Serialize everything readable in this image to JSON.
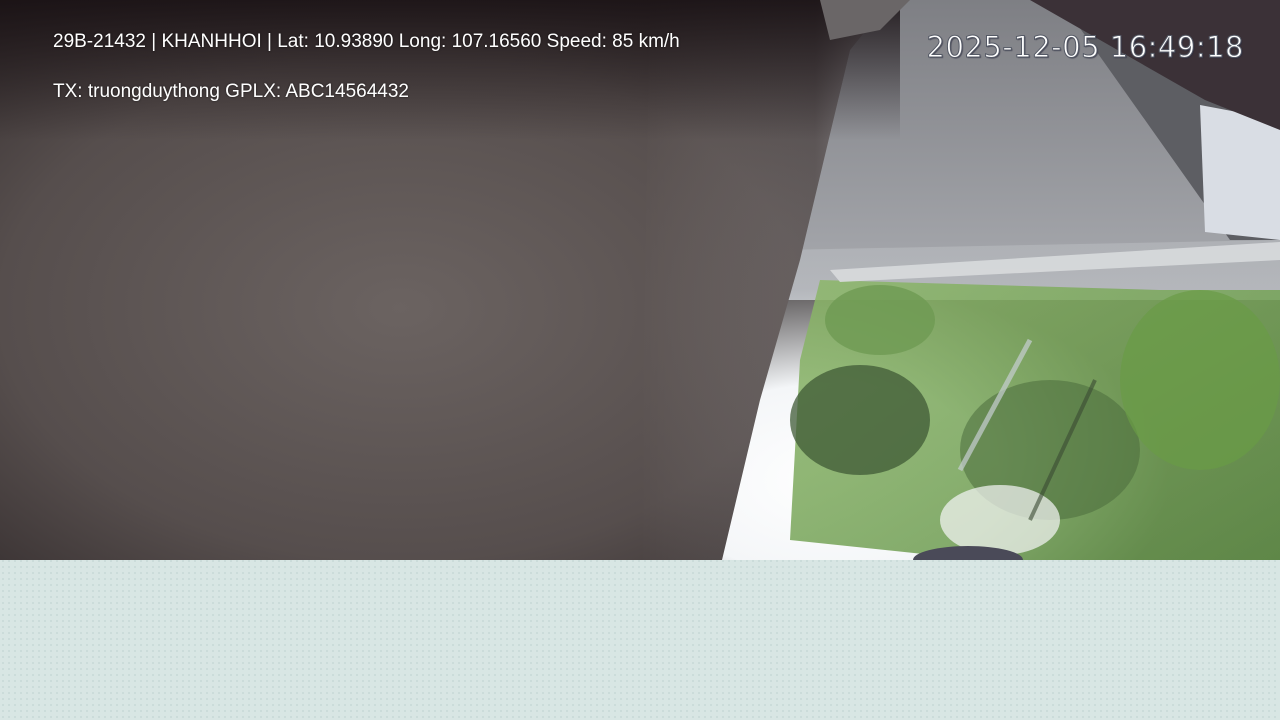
{
  "overlay": {
    "info_line_1": "29B-21432 | KHANHHOI | Lat: 10.93890 Long: 107.16560 Speed: 85 km/h",
    "info_line_2": "TX: truongduythong GPLX: ABC14564432",
    "timestamp": "2025-12-05 16:49:18"
  },
  "colors": {
    "overlay_text": "#ffffff",
    "background": "#d8e6e4",
    "wall": "#5c5452",
    "road": "#8f9094",
    "foliage": "#7aa85a"
  },
  "scene": {
    "description_icons": [
      "dashcam-frame",
      "wall",
      "road",
      "trees",
      "window-glare"
    ]
  }
}
